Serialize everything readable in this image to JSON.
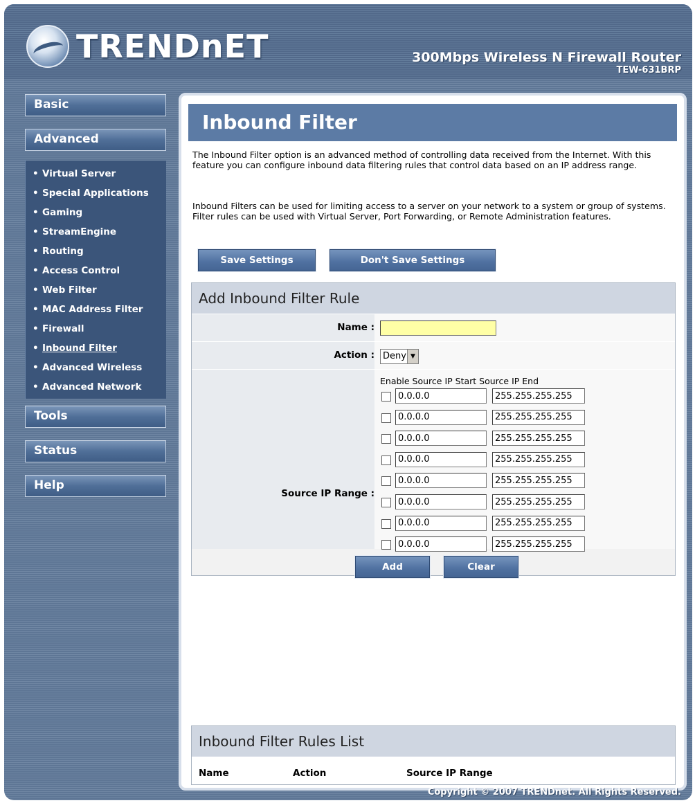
{
  "header": {
    "brand": "TRENDnET",
    "product_title": "300Mbps Wireless N Firewall Router",
    "product_model": "TEW-631BRP"
  },
  "sidebar": {
    "basic": "Basic",
    "advanced": "Advanced",
    "tools": "Tools",
    "status": "Status",
    "help": "Help",
    "advanced_items": [
      {
        "label": "Virtual Server"
      },
      {
        "label": "Special Applications"
      },
      {
        "label": "Gaming"
      },
      {
        "label": "StreamEngine"
      },
      {
        "label": "Routing"
      },
      {
        "label": "Access Control"
      },
      {
        "label": "Web Filter"
      },
      {
        "label": "MAC Address Filter"
      },
      {
        "label": "Firewall"
      },
      {
        "label": "Inbound Filter"
      },
      {
        "label": "Advanced Wireless"
      },
      {
        "label": "Advanced Network"
      }
    ],
    "bullet": "•"
  },
  "main": {
    "page_title": "Inbound Filter",
    "desc1": "The Inbound Filter option is an advanced method of controlling data received from the Internet. With this feature you can configure inbound data filtering rules that control data based on an IP address range.",
    "desc2": "Inbound Filters can be used for limiting access to a server on your network to a system or group of systems. Filter rules can be used with Virtual Server, Port Forwarding, or Remote Administration features.",
    "save_label": "Save Settings",
    "dont_save_label": "Don't Save Settings"
  },
  "rule_form": {
    "heading": "Add Inbound Filter Rule",
    "name_label": "Name :",
    "name_value": "",
    "action_label": "Action :",
    "action_value": "Deny",
    "source_label": "Source IP Range :",
    "columns_header": "Enable Source IP Start Source IP End",
    "ranges": [
      {
        "start": "0.0.0.0",
        "end": "255.255.255.255"
      },
      {
        "start": "0.0.0.0",
        "end": "255.255.255.255"
      },
      {
        "start": "0.0.0.0",
        "end": "255.255.255.255"
      },
      {
        "start": "0.0.0.0",
        "end": "255.255.255.255"
      },
      {
        "start": "0.0.0.0",
        "end": "255.255.255.255"
      },
      {
        "start": "0.0.0.0",
        "end": "255.255.255.255"
      },
      {
        "start": "0.0.0.0",
        "end": "255.255.255.255"
      },
      {
        "start": "0.0.0.0",
        "end": "255.255.255.255"
      }
    ],
    "add_label": "Add",
    "clear_label": "Clear"
  },
  "rules_list": {
    "heading": "Inbound Filter Rules List",
    "col_name": "Name",
    "col_action": "Action",
    "col_source": "Source IP Range"
  },
  "footer": {
    "copyright": "Copyright © 2007 TRENDnet. All Rights Reserved."
  }
}
